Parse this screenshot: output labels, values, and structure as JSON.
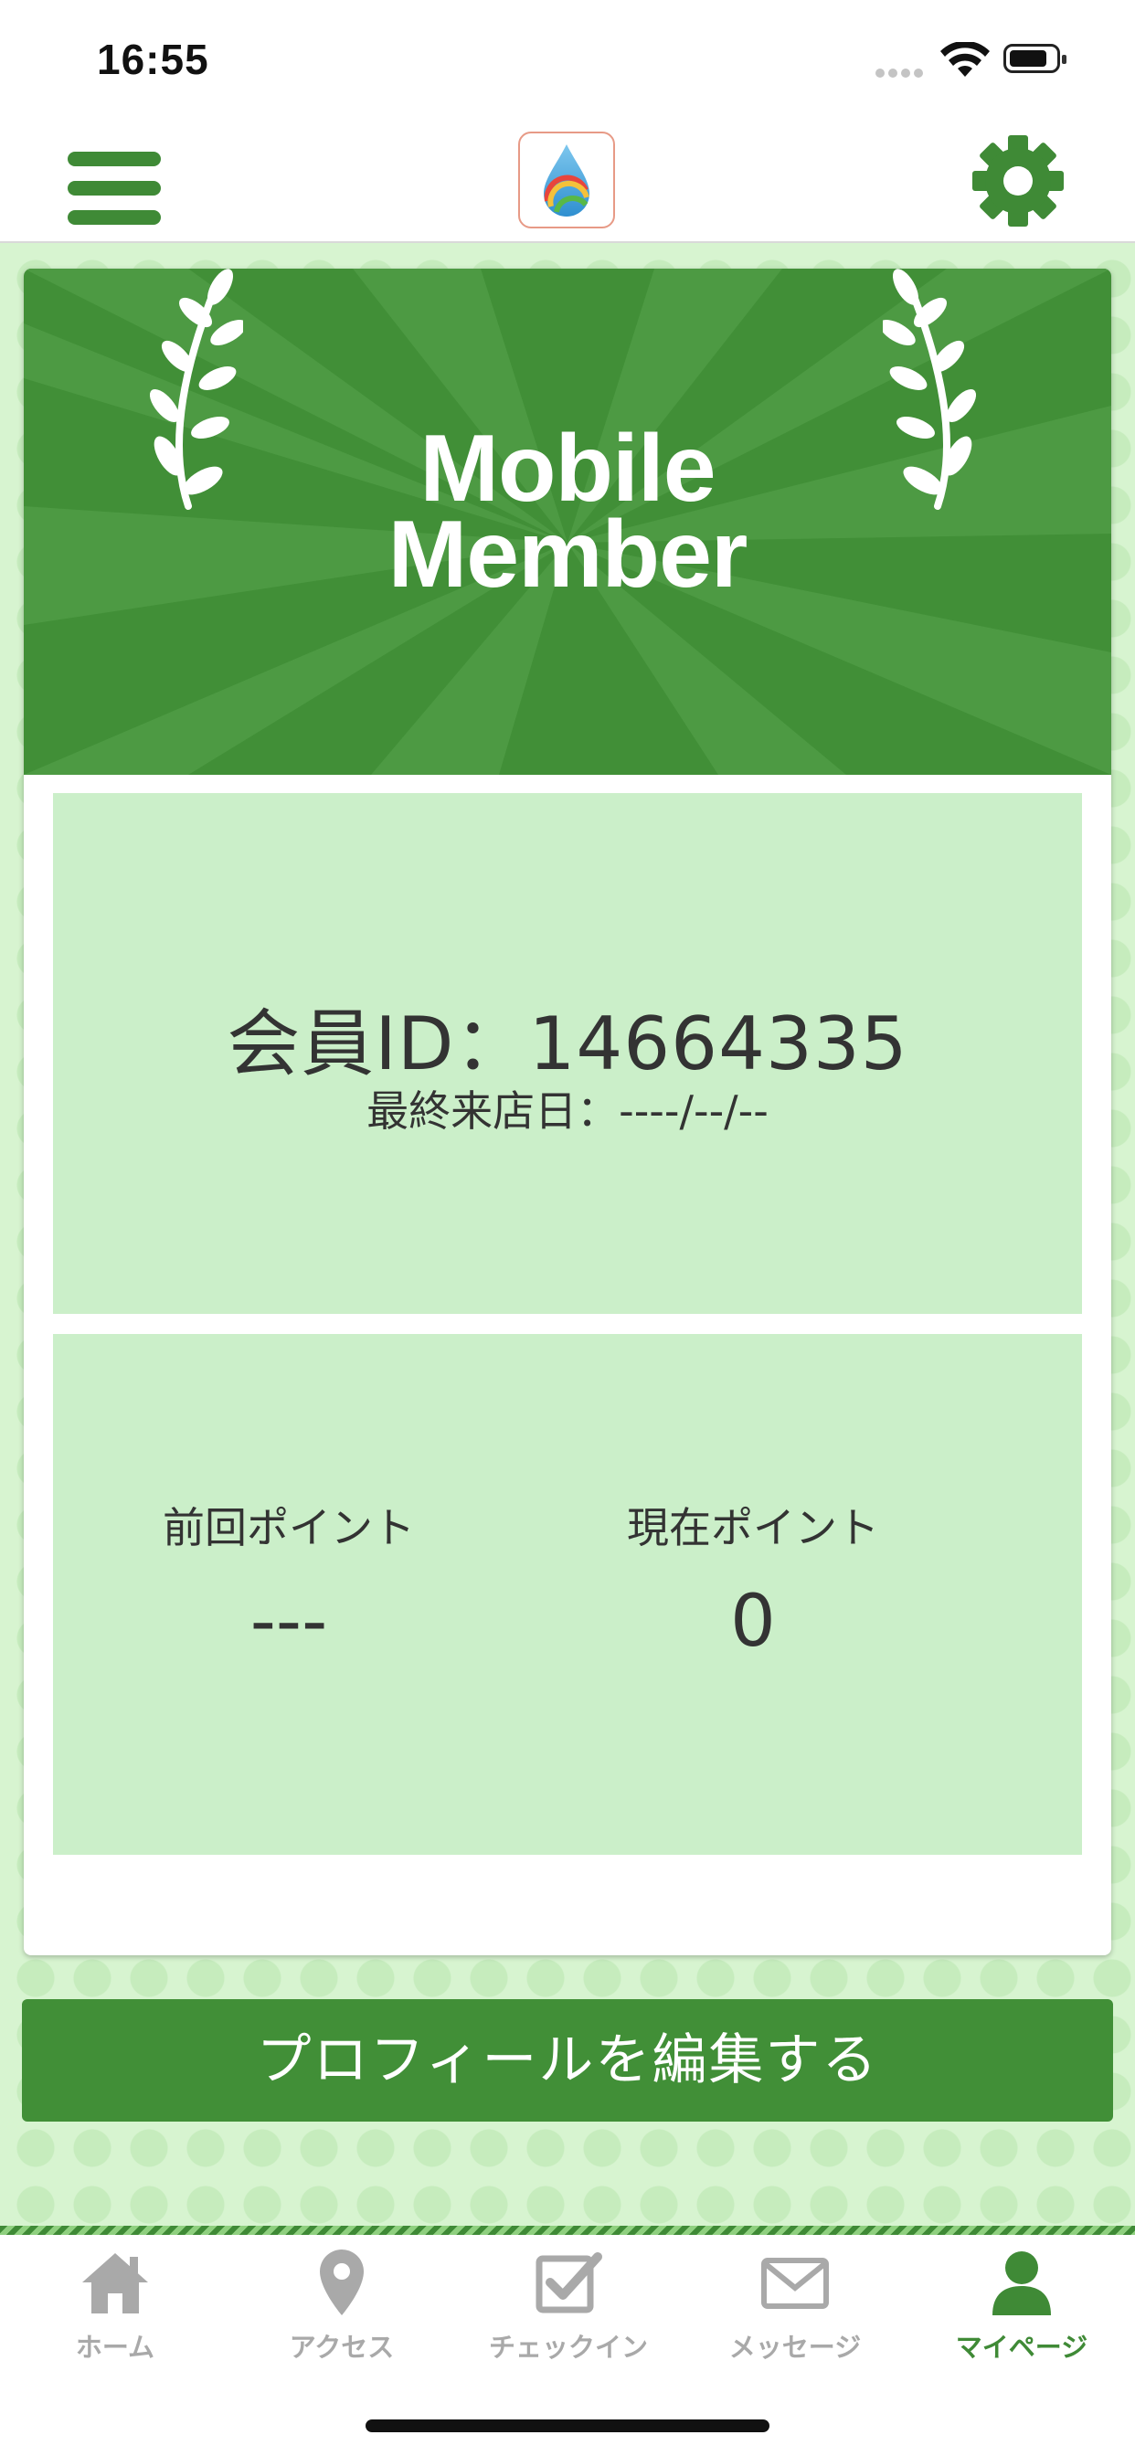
{
  "status_bar": {
    "time": "16:55"
  },
  "header": {
    "menu_icon": "hamburger-menu-icon",
    "logo_icon": "water-drop-logo-icon",
    "settings_icon": "gear-icon"
  },
  "banner": {
    "title_line1": "Mobile",
    "title_line2": "Member"
  },
  "member": {
    "id_text": "会員ID：14664335",
    "last_visit_text": "最終来店日：----/--/--"
  },
  "points": {
    "previous_label": "前回ポイント",
    "previous_value": "---",
    "current_label": "現在ポイント",
    "current_value": "0"
  },
  "edit_profile_label": "プロフィールを編集する",
  "tabs": [
    {
      "label": "ホーム",
      "icon": "home-icon",
      "active": false
    },
    {
      "label": "アクセス",
      "icon": "map-pin-icon",
      "active": false
    },
    {
      "label": "チェックイン",
      "icon": "checkin-icon",
      "active": false
    },
    {
      "label": "メッセージ",
      "icon": "envelope-icon",
      "active": false
    },
    {
      "label": "マイページ",
      "icon": "user-icon",
      "active": true
    }
  ],
  "colors": {
    "primary": "#418f37",
    "panel": "#cbefc9",
    "background": "#d7f4d0",
    "inactive": "#a9a9a9"
  }
}
